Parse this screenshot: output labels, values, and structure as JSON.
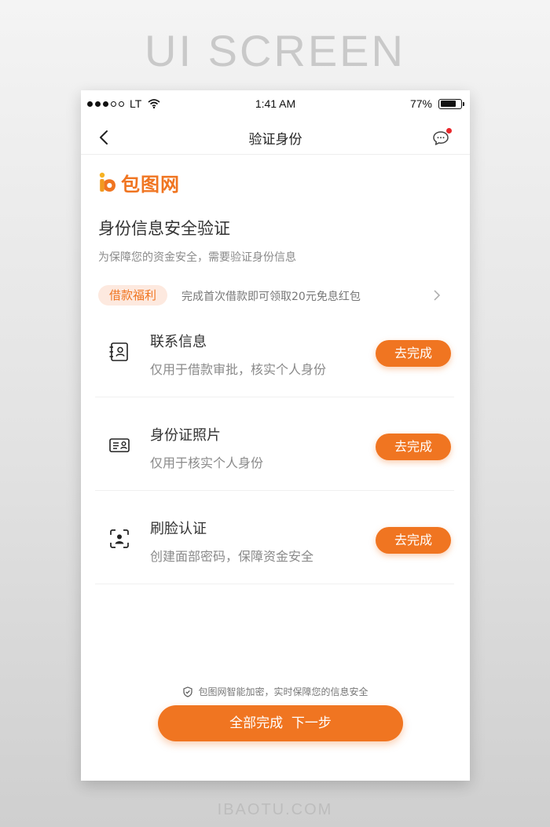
{
  "banner": {
    "title": "UI SCREEN",
    "footer": "IBAOTU.COM"
  },
  "status_bar": {
    "carrier": "LT",
    "time": "1:41 AM",
    "battery": "77%",
    "battery_level": 0.77
  },
  "nav": {
    "title": "验证身份",
    "back_icon": "chevron-left-icon",
    "message_icon": "chat-bubble-icon"
  },
  "logo": {
    "text": "包图网"
  },
  "section": {
    "title": "身份信息安全验证",
    "subtitle": "为保障您的资金安全，需要验证身份信息"
  },
  "promo": {
    "badge": "借款福利",
    "text": "完成首次借款即可领取20元免息红包"
  },
  "items": [
    {
      "title": "联系信息",
      "desc": "仅用于借款审批，核实个人身份",
      "button": "去完成",
      "icon": "contact-card-icon"
    },
    {
      "title": "身份证照片",
      "desc": "仅用于核实个人身份",
      "button": "去完成",
      "icon": "id-card-icon"
    },
    {
      "title": "刷脸认证",
      "desc": "创建面部密码，保障资金安全",
      "button": "去完成",
      "icon": "face-scan-icon"
    }
  ],
  "footer": {
    "secure_note": "包图网智能加密，实时保障您的信息安全",
    "main_button": "全部完成  下一步"
  },
  "colors": {
    "accent": "#f07521",
    "badge_bg": "#fde9df",
    "notification": "#e9272b"
  }
}
